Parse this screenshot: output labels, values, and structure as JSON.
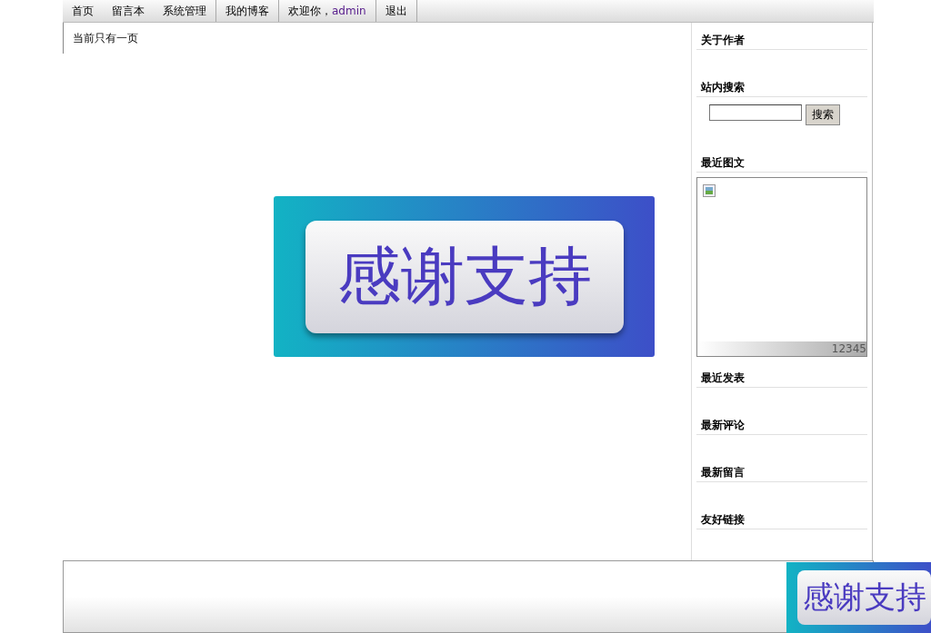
{
  "nav": {
    "items": [
      {
        "label": "首页",
        "divider_after": false
      },
      {
        "label": "留言本",
        "divider_after": false
      },
      {
        "label": "系统管理",
        "divider_after": true
      },
      {
        "label": "我的博客",
        "divider_after": true
      },
      {
        "label": "欢迎你，",
        "user": "admin",
        "divider_after": true
      },
      {
        "label": "退出",
        "divider_after": true
      }
    ]
  },
  "main": {
    "pager_note": "当前只有一页",
    "banner": {
      "text": "感谢支持"
    }
  },
  "sidebar": {
    "sections": [
      {
        "kind": "plain",
        "title": "关于作者"
      },
      {
        "kind": "search",
        "title": "站内搜索",
        "button": "搜索"
      },
      {
        "kind": "slideshow",
        "title": "最近图文",
        "pages": [
          "1",
          "2",
          "3",
          "4",
          "5"
        ]
      },
      {
        "kind": "plain",
        "title": "最近发表"
      },
      {
        "kind": "plain",
        "title": "最新评论"
      },
      {
        "kind": "plain",
        "title": "最新留言"
      },
      {
        "kind": "plain",
        "title": "友好链接"
      }
    ]
  },
  "floating_banner": {
    "text": "感谢支持"
  }
}
